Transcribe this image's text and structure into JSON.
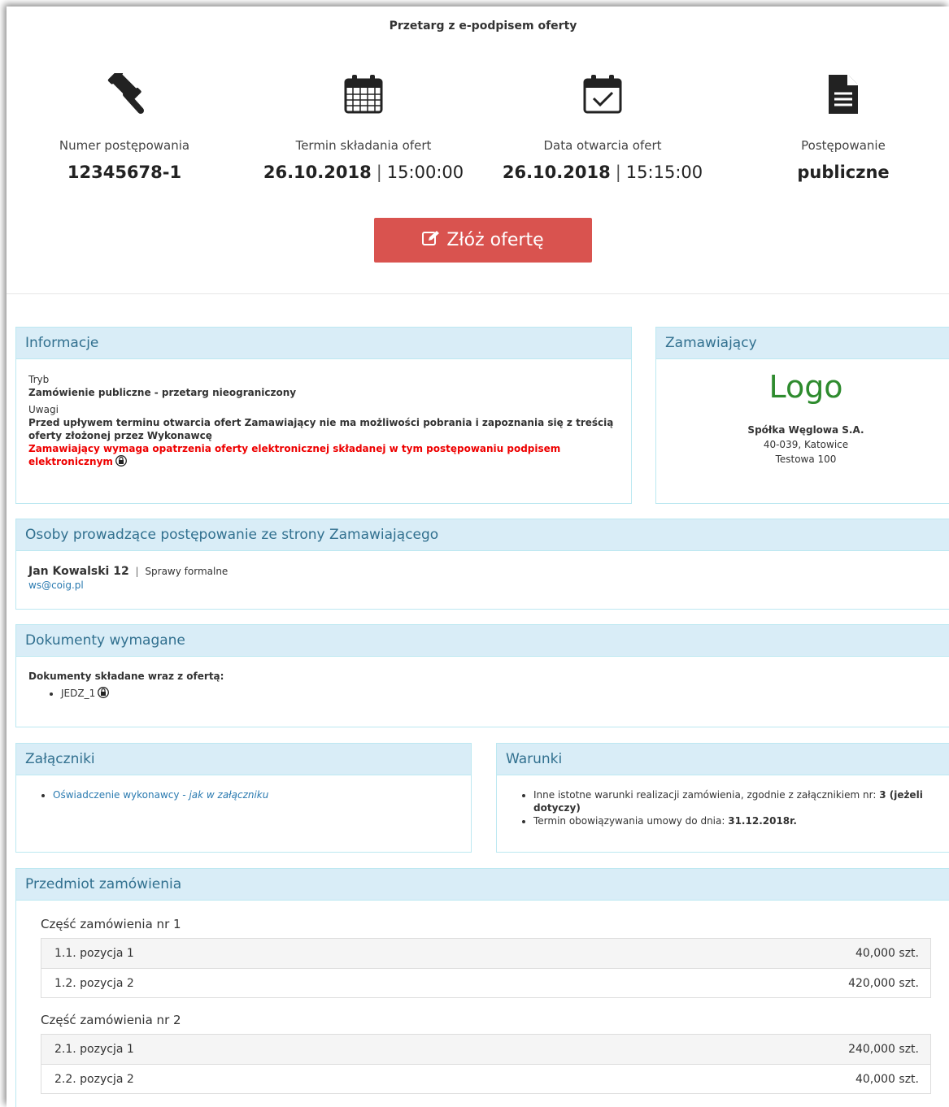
{
  "title": "Przetarg z e-podpisem oferty",
  "stats": {
    "number": {
      "label": "Numer postępowania",
      "value": "12345678-1",
      "icon": "gavel-icon"
    },
    "deadline": {
      "label": "Termin składania ofert",
      "date": "26.10.2018",
      "sep": "|",
      "time": "15:00:00",
      "icon": "calendar-icon"
    },
    "opening": {
      "label": "Data otwarcia ofert",
      "date": "26.10.2018",
      "sep": "|",
      "time": "15:15:00",
      "icon": "calendar-check-icon"
    },
    "type": {
      "label": "Postępowanie",
      "value": "publiczne",
      "icon": "document-icon"
    }
  },
  "offer_button": {
    "label": "Złóż ofertę",
    "icon": "edit-icon",
    "color": "#d9534f"
  },
  "info": {
    "heading": "Informacje",
    "mode_label": "Tryb",
    "mode_value": "Zamówienie publiczne - przetarg nieograniczony",
    "notes_label": "Uwagi",
    "notes_value": "Przed upływem terminu otwarcia ofert Zamawiający nie ma możliwości pobrania i zapoznania się z treścią oferty złożonej przez Wykonawcę",
    "notes_red": "Zamawiający wymaga opatrzenia oferty elektronicznej składanej w tym postępowaniu podpisem elektronicznym"
  },
  "buyer": {
    "heading": "Zamawiający",
    "logo": "Logo",
    "name": "Spółka Węglowa S.A.",
    "city": "40-039, Katowice",
    "street": "Testowa 100"
  },
  "contacts": {
    "heading": "Osoby prowadzące postępowanie ze strony Zamawiającego",
    "name": "Jan Kowalski 12",
    "sep": "|",
    "role": "Sprawy formalne",
    "email": "ws@coig.pl"
  },
  "documents": {
    "heading": "Dokumenty wymagane",
    "subheading": "Dokumenty składane wraz z ofertą:",
    "items": [
      "JEDZ_1"
    ]
  },
  "attachments": {
    "heading": "Załączniki",
    "link": "Oświadczenie wykonawcy",
    "note": " - jak w załączniku"
  },
  "conditions": {
    "heading": "Warunki",
    "c1_text": "Inne istotne warunki realizacji zamówienia, zgodnie z załącznikiem nr: ",
    "c1_bold": "3 (jeżeli dotyczy)",
    "c2_text": "Termin obowiązywania umowy do dnia: ",
    "c2_bold": "31.12.2018r."
  },
  "subject": {
    "heading": "Przedmiot zamówienia",
    "parts": [
      {
        "title": "Część zamówienia nr 1",
        "items": [
          {
            "name": "1.1. pozycja 1",
            "qty": "40,000 szt."
          },
          {
            "name": "1.2. pozycja 2",
            "qty": "420,000 szt."
          }
        ]
      },
      {
        "title": "Część zamówienia nr 2",
        "items": [
          {
            "name": "2.1. pozycja 1",
            "qty": "240,000 szt."
          },
          {
            "name": "2.2. pozycja 2",
            "qty": "40,000 szt."
          }
        ]
      }
    ]
  }
}
